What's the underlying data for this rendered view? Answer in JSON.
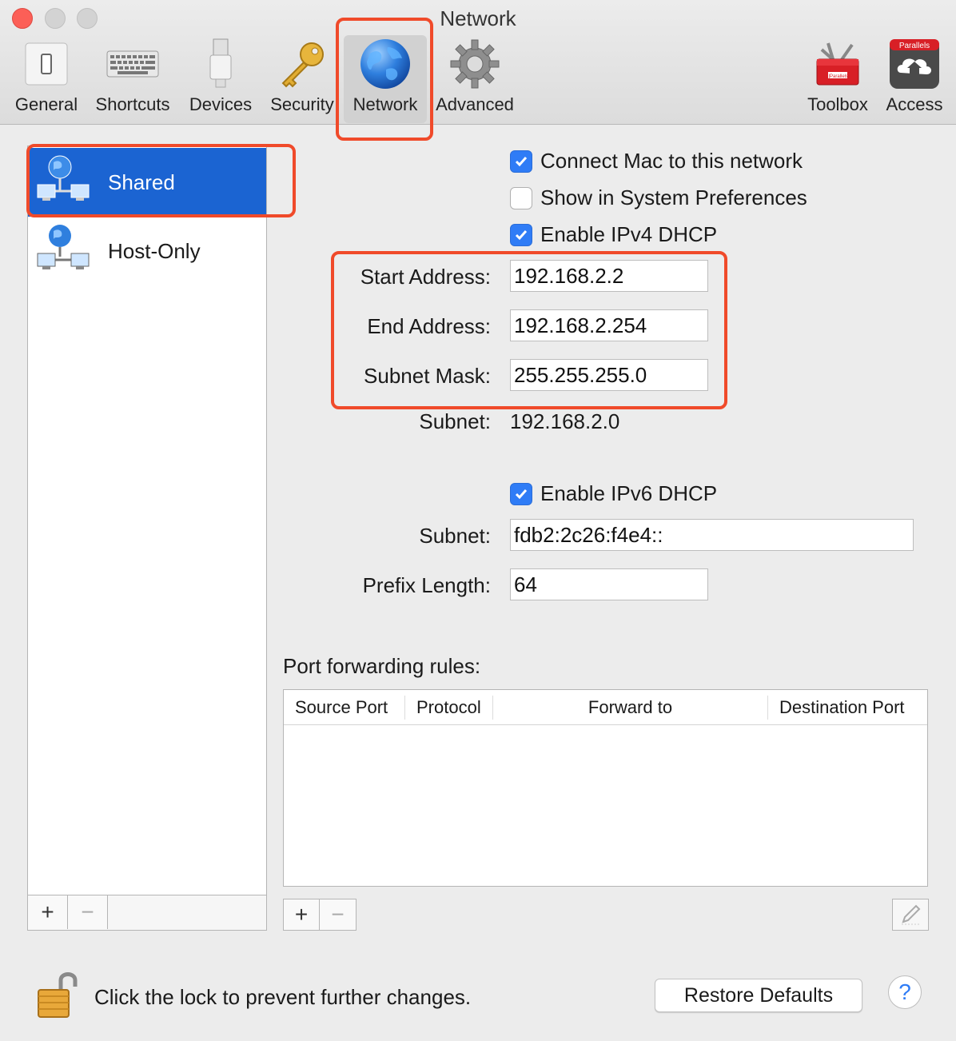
{
  "window": {
    "title": "Network"
  },
  "toolbar": {
    "items": [
      {
        "label": "General"
      },
      {
        "label": "Shortcuts"
      },
      {
        "label": "Devices"
      },
      {
        "label": "Security"
      },
      {
        "label": "Network"
      },
      {
        "label": "Advanced"
      },
      {
        "label": "Toolbox"
      },
      {
        "label": "Access"
      }
    ],
    "selected": "Network",
    "brand_badge": "Parallels"
  },
  "sidebar": {
    "items": [
      {
        "label": "Shared",
        "selected": true
      },
      {
        "label": "Host-Only",
        "selected": false
      }
    ],
    "add_label": "+",
    "remove_label": "−"
  },
  "settings": {
    "connect_mac": {
      "label": "Connect Mac to this network",
      "checked": true
    },
    "show_in_prefs": {
      "label": "Show in System Preferences",
      "checked": false
    },
    "ipv4_dhcp": {
      "label": "Enable IPv4 DHCP",
      "checked": true
    },
    "start_address": {
      "label": "Start Address:",
      "value": "192.168.2.2"
    },
    "end_address": {
      "label": "End Address:",
      "value": "192.168.2.254"
    },
    "subnet_mask": {
      "label": "Subnet Mask:",
      "value": "255.255.255.0"
    },
    "subnet_v4": {
      "label": "Subnet:",
      "value": "192.168.2.0"
    },
    "ipv6_dhcp": {
      "label": "Enable IPv6 DHCP",
      "checked": true
    },
    "subnet_v6": {
      "label": "Subnet:",
      "value": "fdb2:2c26:f4e4::"
    },
    "prefix_length": {
      "label": "Prefix Length:",
      "value": "64"
    }
  },
  "port_forwarding": {
    "title": "Port forwarding rules:",
    "columns": [
      "Source Port",
      "Protocol",
      "Forward to",
      "Destination Port"
    ],
    "rows": [],
    "add_label": "+",
    "remove_label": "−"
  },
  "footer": {
    "lock_text": "Click the lock to prevent further changes.",
    "restore_label": "Restore Defaults",
    "help_label": "?"
  },
  "colors": {
    "accent": "#2f7cf6",
    "selection": "#1b64d2",
    "highlight_box": "#f04a2a"
  }
}
